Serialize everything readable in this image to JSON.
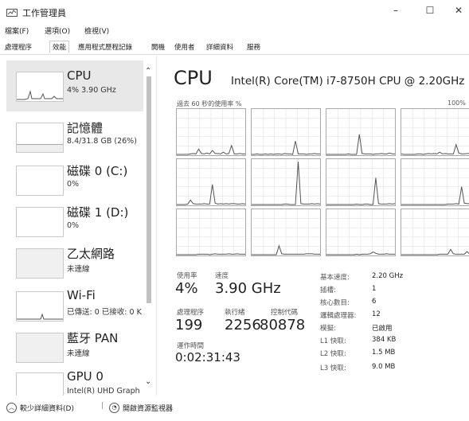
{
  "window": {
    "title": "工作管理員",
    "minimize": "–",
    "maximize": "☐",
    "close": "✕"
  },
  "menu": [
    "檔案(F)",
    "選項(O)",
    "檢視(V)"
  ],
  "tabs": [
    "處理程序",
    "效能",
    "應用程式歷程記錄",
    "開機",
    "使用者",
    "詳細資料",
    "服務"
  ],
  "active_tab": 1,
  "resources": [
    {
      "name": "CPU",
      "sub": "4% 3.90 GHz"
    },
    {
      "name": "記憶體",
      "sub": "8.4/31.8 GB (26%)"
    },
    {
      "name": "磁碟 0 (C:)",
      "sub": "0%"
    },
    {
      "name": "磁碟 1 (D:)",
      "sub": "0%"
    },
    {
      "name": "乙太網路",
      "sub": "未連線"
    },
    {
      "name": "Wi-Fi",
      "sub": "已傳送: 0 已接收: 0 K"
    },
    {
      "name": "藍牙 PAN",
      "sub": "未連線"
    },
    {
      "name": "GPU 0",
      "sub": "Intel(R) UHD Graph"
    }
  ],
  "cpu": {
    "title": "CPU",
    "model": "Intel(R) Core(TM) i7-8750H CPU @ 2.20GHz",
    "chart_caption": "過去 60 秒的使用率 %",
    "chart_max": "100%",
    "stats": {
      "utilization_label": "使用率",
      "utilization": "4%",
      "speed_label": "速度",
      "speed": "3.90 GHz",
      "processes_label": "處理程序",
      "processes": "199",
      "threads_label": "執行緒",
      "threads": "2256",
      "handles_label": "控制代碼",
      "handles": "80878",
      "uptime_label": "運作時間",
      "uptime": "0:02:31:43"
    },
    "specs": [
      {
        "label": "基本速度:",
        "value": "2.20 GHz"
      },
      {
        "label": "插槽:",
        "value": "1"
      },
      {
        "label": "核心數目:",
        "value": "6"
      },
      {
        "label": "邏輯處理器:",
        "value": "12"
      },
      {
        "label": "模擬:",
        "value": "已啟用"
      },
      {
        "label": "L1 快取:",
        "value": "384 KB"
      },
      {
        "label": "L2 快取:",
        "value": "1.5 MB"
      },
      {
        "label": "L3 快取:",
        "value": "9.0 MB"
      }
    ]
  },
  "footer": {
    "fewer_details": "較少詳細資料(D)",
    "separator": "|",
    "resource_monitor": "開啟資源監視器"
  },
  "colors": {
    "graph_line": "#555555",
    "grid_line": "#dddddd",
    "selected_bg": "#e8e8e8"
  },
  "cores": [
    [
      0,
      0,
      0,
      0,
      0,
      1,
      2,
      1,
      12,
      2,
      1,
      3,
      1,
      9,
      2,
      2,
      1,
      5,
      1,
      2,
      20,
      1,
      1,
      2,
      1,
      1
    ],
    [
      0,
      0,
      1,
      0,
      0,
      1,
      0,
      1,
      0,
      1,
      1,
      0,
      2,
      1,
      1,
      0,
      30,
      1,
      1,
      1,
      0,
      1,
      1,
      2,
      1,
      1
    ],
    [
      0,
      0,
      0,
      0,
      0,
      0,
      0,
      0,
      1,
      0,
      0,
      0,
      45,
      2,
      1,
      1,
      1,
      0,
      1,
      1,
      2,
      1,
      1,
      3,
      1,
      1
    ],
    [
      1,
      0,
      0,
      0,
      0,
      0,
      1,
      1,
      0,
      1,
      2,
      1,
      2,
      1,
      5,
      1,
      2,
      1,
      1,
      1,
      22,
      3,
      1,
      1,
      2,
      2
    ],
    [
      0,
      0,
      0,
      0,
      1,
      10,
      2,
      1,
      1,
      1,
      2,
      1,
      1,
      45,
      3,
      1,
      2,
      1,
      2,
      1,
      2,
      2,
      1,
      1,
      2,
      1
    ],
    [
      0,
      0,
      0,
      0,
      0,
      0,
      0,
      0,
      0,
      0,
      0,
      0,
      1,
      1,
      0,
      0,
      0,
      96,
      2,
      1,
      1,
      1,
      2,
      1,
      2,
      1
    ],
    [
      0,
      0,
      0,
      0,
      0,
      0,
      0,
      0,
      0,
      0,
      0,
      1,
      0,
      0,
      1,
      1,
      0,
      0,
      60,
      2,
      1,
      1,
      1,
      2,
      1,
      2
    ],
    [
      0,
      0,
      0,
      0,
      0,
      0,
      0,
      0,
      0,
      0,
      0,
      0,
      0,
      0,
      0,
      0,
      0,
      1,
      1,
      1,
      2,
      1,
      40,
      3,
      2,
      2
    ],
    [
      0,
      0,
      0,
      0,
      0,
      0,
      0,
      0,
      1,
      1,
      1,
      1,
      0,
      1,
      2,
      1,
      1,
      1,
      1,
      2,
      1,
      1,
      2,
      1,
      1,
      1
    ],
    [
      0,
      0,
      0,
      0,
      0,
      0,
      0,
      0,
      0,
      0,
      20,
      2,
      1,
      1,
      1,
      1,
      1,
      1,
      1,
      1,
      2,
      2,
      2,
      1,
      1,
      1
    ],
    [
      0,
      0,
      0,
      0,
      0,
      0,
      0,
      0,
      0,
      0,
      0,
      1,
      0,
      1,
      1,
      1,
      2,
      6,
      3,
      1,
      1,
      1,
      2,
      1,
      1,
      1
    ],
    [
      0,
      0,
      0,
      0,
      0,
      0,
      0,
      0,
      0,
      0,
      0,
      0,
      0,
      0,
      1,
      1,
      1,
      1,
      12,
      2,
      1,
      1,
      1,
      1,
      7,
      1
    ]
  ]
}
